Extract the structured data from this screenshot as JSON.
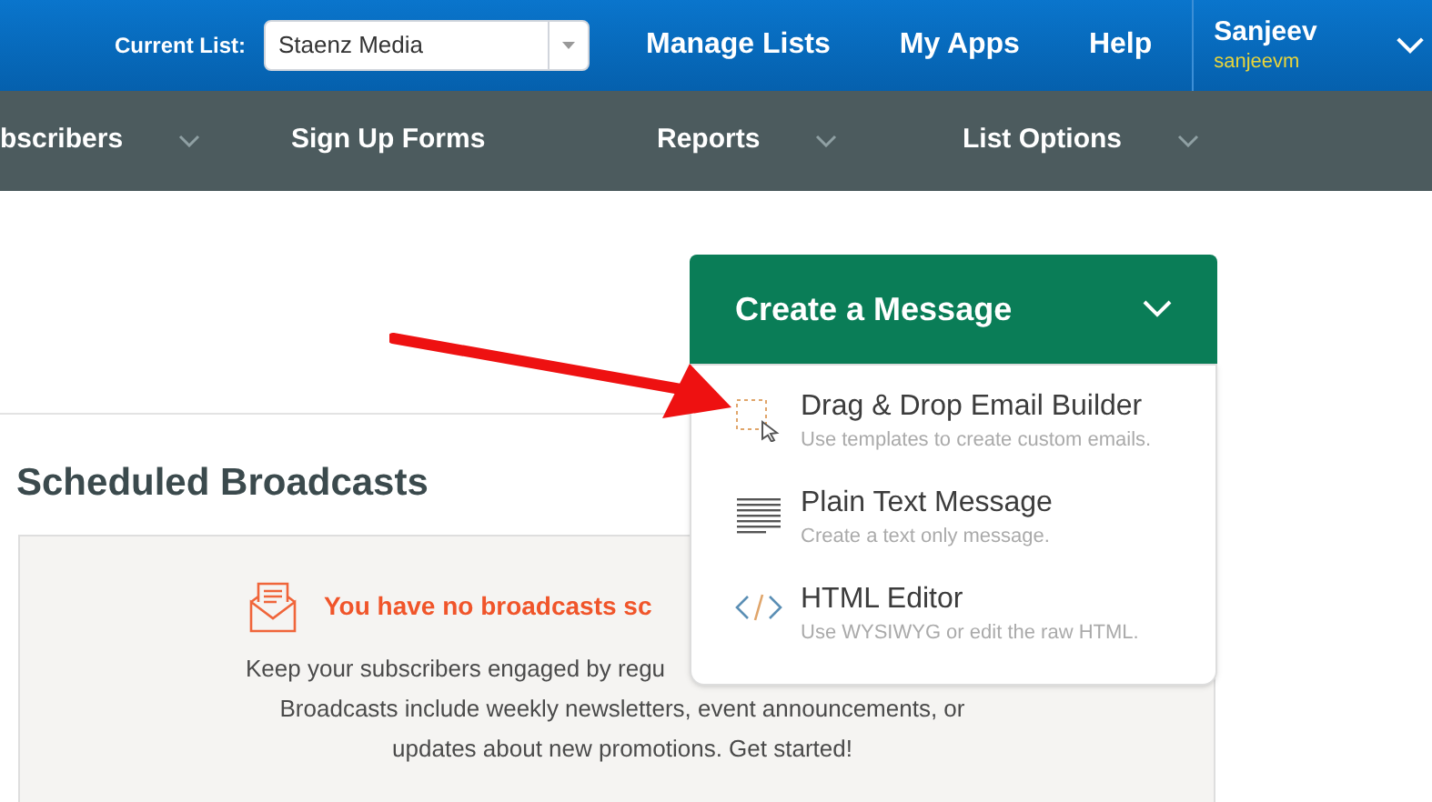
{
  "header": {
    "current_list_label": "Current List:",
    "current_list_value": "Staenz Media",
    "links": [
      "Manage Lists",
      "My Apps",
      "Help"
    ],
    "user": {
      "name": "Sanjeev",
      "username": "sanjeevm"
    }
  },
  "nav": [
    {
      "label": "bscribers",
      "has_caret": true
    },
    {
      "label": "Sign Up Forms",
      "has_caret": false
    },
    {
      "label": "Reports",
      "has_caret": true
    },
    {
      "label": "List Options",
      "has_caret": true
    }
  ],
  "create_button": {
    "label": "Create a Message",
    "expanded": true
  },
  "menu": [
    {
      "kind": "dragdrop",
      "title": "Drag & Drop Email Builder",
      "description": "Use templates to create custom emails."
    },
    {
      "kind": "plaintext",
      "title": "Plain Text Message",
      "description": "Create a text only message."
    },
    {
      "kind": "html",
      "title": "HTML Editor",
      "description": "Use WYSIWYG or edit the raw HTML."
    }
  ],
  "section_title": "Scheduled Broadcasts",
  "empty_state": {
    "title": "You have no broadcasts sc",
    "lines": [
      "Keep your subscribers engaged by regu",
      "Broadcasts include weekly newsletters, event announcements, or",
      "updates about new promotions. Get started!"
    ]
  }
}
